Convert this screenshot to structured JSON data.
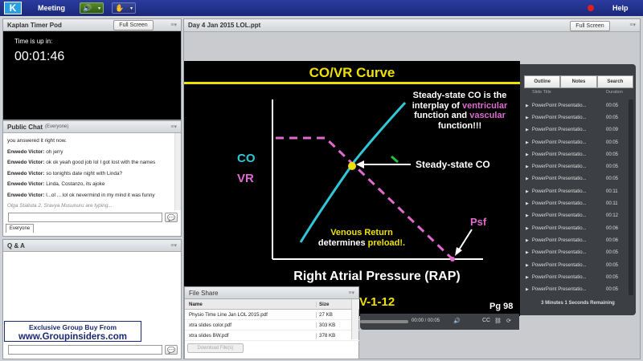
{
  "topbar": {
    "logo": "K",
    "menu_meeting": "Meeting",
    "help": "Help"
  },
  "timer_pod": {
    "title": "Kaplan Timer Pod",
    "full_screen": "Full Screen",
    "label": "Time is up in:",
    "value": "00:01:46"
  },
  "chat_pod": {
    "title": "Public Chat",
    "scope": "(Everyone)",
    "messages": [
      {
        "name": "",
        "text": "you answered it right now."
      },
      {
        "name": "Enwedo Victor:",
        "text": "oh jerry"
      },
      {
        "name": "Enwedo Victor:",
        "text": "ok ok yeah good job lol I got lost with the names"
      },
      {
        "name": "Enwedo Victor:",
        "text": "so tonights date night with Linda?"
      },
      {
        "name": "Enwedo Victor:",
        "text": "Linda, Costanzo, its ajoke"
      },
      {
        "name": "Enwedo Victor:",
        "text": "l...ol ... lol ok nevermind in my mind it was funny"
      }
    ],
    "typing": "Olga Staliuta 2, Sravya Musunuru are typing...",
    "tab": "Everyone"
  },
  "qa_pod": {
    "title": "Q & A"
  },
  "watermark": {
    "line1": "Exclusive Group Buy From",
    "line2": "www.Groupinsiders.com"
  },
  "share_pod": {
    "title": "Day 4 Jan 2015 LOL.ppt",
    "full_screen": "Full Screen"
  },
  "slide": {
    "title": "CO/VR Curve",
    "co": "CO",
    "vr": "VR",
    "annot1": [
      "Steady-state CO is the",
      "interplay of",
      "ventricular",
      "function and",
      "vascular",
      "function!!!"
    ],
    "steady": "Steady-state CO",
    "venous1": "Venous Return",
    "venous2": "determines",
    "preload": "preload!.",
    "psf": "Psf",
    "xaxis": "Right Atrial Pressure (RAP)",
    "code": "V-1-12",
    "page": "Pg 98",
    "colors": {
      "cyan": "#30c8d8",
      "pink": "#e06ad0",
      "yellow": "#f0e000"
    }
  },
  "presentation": {
    "tabs": [
      "Outline",
      "Notes",
      "Search"
    ],
    "col_title": "Slide Title",
    "col_duration": "Duration",
    "slides": [
      {
        "title": "PowerPoint Presentatio...",
        "duration": "00:05"
      },
      {
        "title": "PowerPoint Presentatio...",
        "duration": "00:05"
      },
      {
        "title": "PowerPoint Presentatio...",
        "duration": "00:09"
      },
      {
        "title": "PowerPoint Presentatio...",
        "duration": "00:05"
      },
      {
        "title": "PowerPoint Presentatio...",
        "duration": "00:05"
      },
      {
        "title": "PowerPoint Presentatio...",
        "duration": "00:05"
      },
      {
        "title": "PowerPoint Presentatio...",
        "duration": "00:05"
      },
      {
        "title": "PowerPoint Presentatio...",
        "duration": "00:11"
      },
      {
        "title": "PowerPoint Presentatio...",
        "duration": "00:11"
      },
      {
        "title": "PowerPoint Presentatio...",
        "duration": "00:12"
      },
      {
        "title": "PowerPoint Presentatio...",
        "duration": "00:06"
      },
      {
        "title": "PowerPoint Presentatio...",
        "duration": "00:06"
      },
      {
        "title": "PowerPoint Presentatio...",
        "duration": "00:05"
      },
      {
        "title": "PowerPoint Presentatio...",
        "duration": "00:05"
      },
      {
        "title": "PowerPoint Presentatio...",
        "duration": "00:05"
      },
      {
        "title": "PowerPoint Presentatio...",
        "duration": "00:05"
      }
    ],
    "remaining": "3 Minutes 1 Seconds Remaining",
    "time": "00:00 / 00:05"
  },
  "file_share": {
    "title": "File Share",
    "col_name": "Name",
    "col_size": "Size",
    "files": [
      {
        "name": "Physio Time Line Jan LOL 2015.pdf",
        "size": "27 KB"
      },
      {
        "name": "xtra slides color.pdf",
        "size": "303 KB"
      },
      {
        "name": "xtra slides BW.pdf",
        "size": "378 KB"
      }
    ],
    "download": "Download File(s)"
  }
}
